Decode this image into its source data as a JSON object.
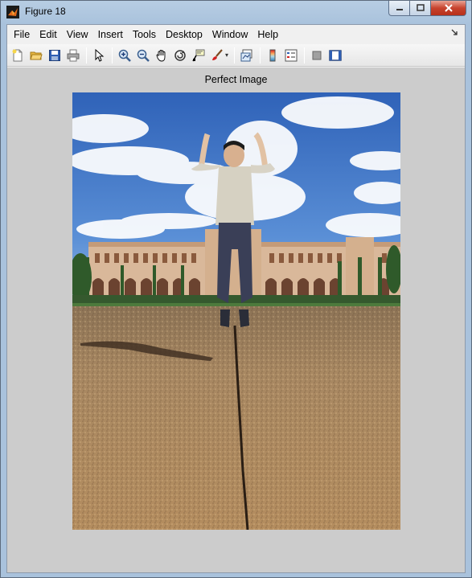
{
  "window": {
    "title": "Figure 18",
    "buttons": {
      "minimize": "minimize",
      "maximize": "maximize",
      "close": "close"
    }
  },
  "menubar": {
    "items": [
      "File",
      "Edit",
      "View",
      "Insert",
      "Tools",
      "Desktop",
      "Window",
      "Help"
    ]
  },
  "toolbar": {
    "icons": [
      "new-figure-icon",
      "open-file-icon",
      "save-icon",
      "print-icon",
      "edit-plot-arrow-icon",
      "zoom-in-icon",
      "zoom-out-icon",
      "pan-hand-icon",
      "rotate-3d-icon",
      "data-cursor-icon",
      "brush-icon",
      "link-plot-icon",
      "colorbar-icon",
      "legend-icon",
      "hide-plot-tools-icon",
      "show-plot-tools-icon"
    ]
  },
  "axes": {
    "title": "Perfect Image",
    "image_description": "photo"
  }
}
